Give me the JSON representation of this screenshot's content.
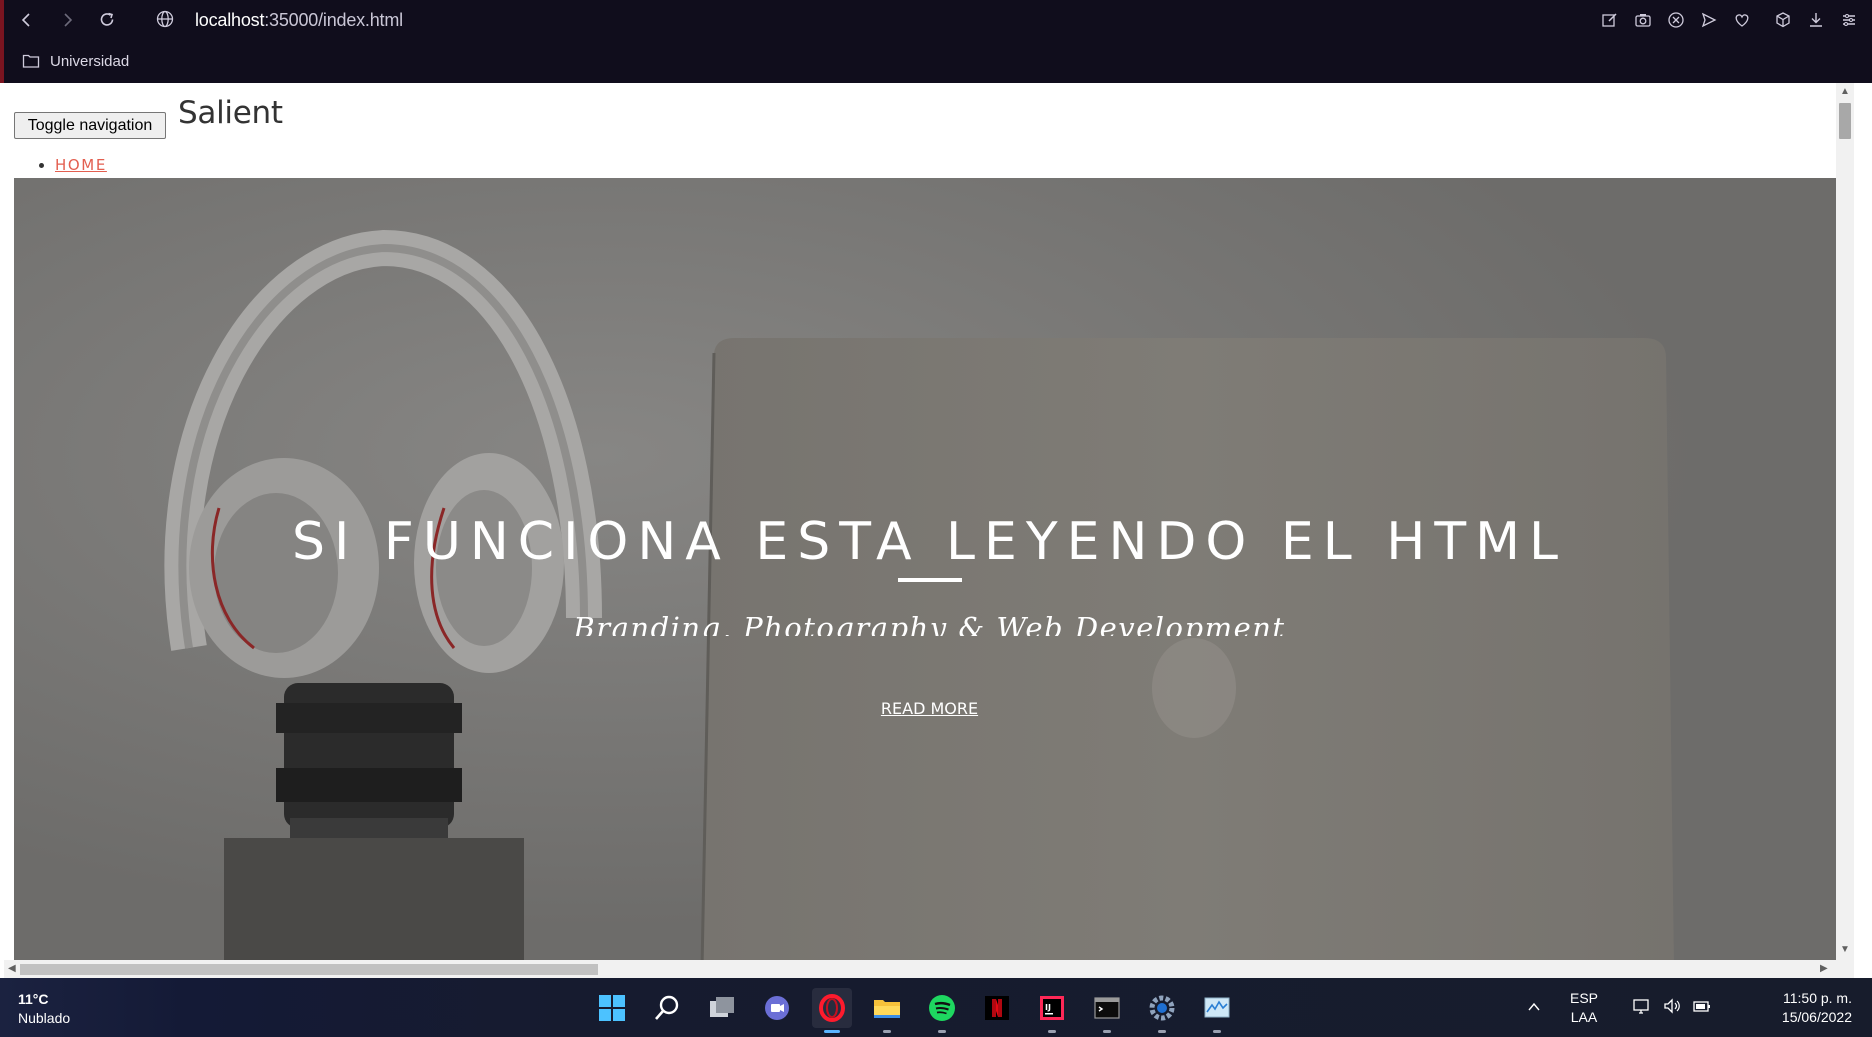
{
  "browser": {
    "url_host": "localhost",
    "url_path": ":35000/index.html",
    "bookmark_folder": "Universidad",
    "toolbar_icons": [
      "snapshot-edit-icon",
      "camera-icon",
      "close-circle-icon",
      "send-icon",
      "heart-icon",
      "cube-icon",
      "download-icon",
      "menu-icon"
    ]
  },
  "page": {
    "toggle_label": "Toggle navigation",
    "brand": "Salient",
    "nav_items": [
      "HOME"
    ],
    "hero": {
      "title": "SI FUNCIONA ESTA LEYENDO EL HTML",
      "subtitle": "Branding, Photography & Web Development",
      "read_more": "READ MORE"
    }
  },
  "taskbar": {
    "weather_temp": "11°C",
    "weather_desc": "Nublado",
    "apps": [
      "windows-start-icon",
      "search-icon",
      "task-view-icon",
      "teams-chat-icon",
      "opera-icon",
      "file-explorer-icon",
      "spotify-icon",
      "netflix-icon",
      "intellij-icon",
      "terminal-icon",
      "settings-icon",
      "resource-monitor-icon"
    ],
    "lang_1": "ESP",
    "lang_2": "LAA",
    "time": "11:50 p. m.",
    "date": "15/06/2022"
  },
  "colors": {
    "chrome_bg": "#100d1c",
    "nav_link": "#e35f50",
    "taskbar_bg": "#171c2c",
    "hero_overlay": "#6f6f6d"
  }
}
